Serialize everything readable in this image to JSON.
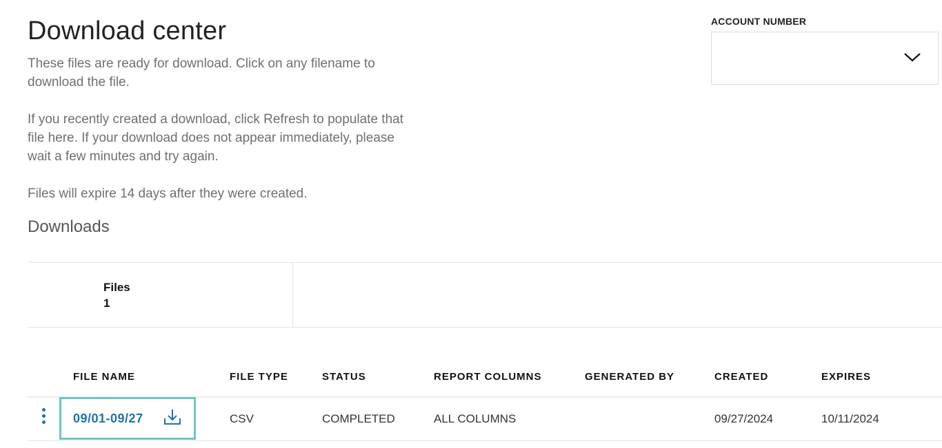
{
  "page": {
    "title": "Download center",
    "intro_paragraphs": [
      "These files are ready for download. Click on any filename to download the file.",
      "If you recently created a download, click Refresh to populate that file here. If your download does not appear immediately, please wait a few minutes and try again.",
      "Files will expire 14 days after they were created."
    ],
    "downloads_heading": "Downloads"
  },
  "account": {
    "label": "ACCOUNT NUMBER",
    "selected_value": "",
    "icon": "chevron-down-icon"
  },
  "summary": {
    "files_label": "Files",
    "files_count": "1"
  },
  "table": {
    "columns": [
      "FILE NAME",
      "FILE TYPE",
      "STATUS",
      "REPORT COLUMNS",
      "GENERATED BY",
      "CREATED",
      "EXPIRES"
    ],
    "rows": [
      {
        "file_name": "09/01-09/27",
        "file_type": "CSV",
        "status": "COMPLETED",
        "report_columns": "ALL COLUMNS",
        "generated_by": "",
        "created": "09/27/2024",
        "expires": "10/11/2024"
      }
    ]
  },
  "colors": {
    "link": "#1b74a8",
    "focus_outline": "#6ac7c1",
    "kebab": "#1777a7",
    "muted_text": "#6f6f6f"
  }
}
